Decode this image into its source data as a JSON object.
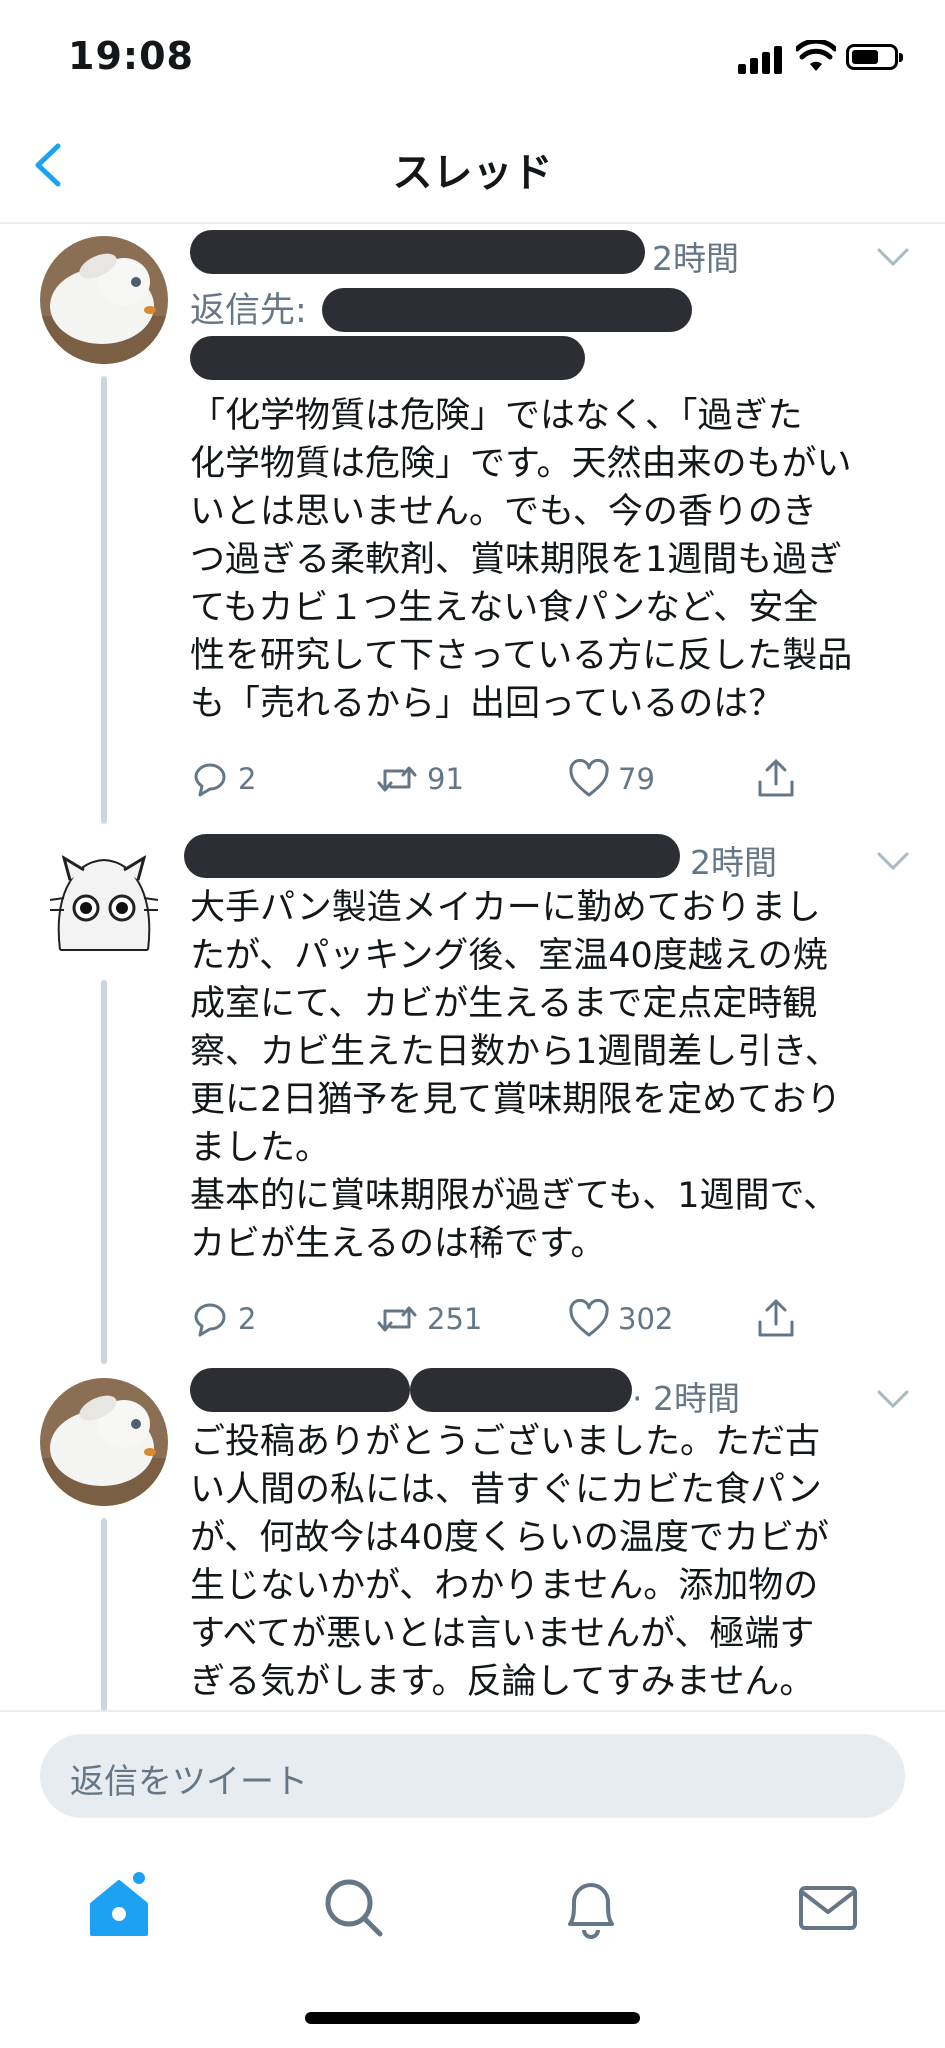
{
  "status_bar": {
    "time": "19:08"
  },
  "nav": {
    "title": "スレッド"
  },
  "tweets": [
    {
      "time": "2時間",
      "reply_to_label": "返信先:",
      "text": "「化学物質は危険」ではなく、「過ぎた\n化学物質は危険」です。天然由来のもがい\nいとは思いません。でも、今の香りのき\nつ過ぎる柔軟剤、賞味期限を1週間も過ぎ\nてもカビ１つ生えない食パンなど、安全\n性を研究して下さっている方に反した製品\nも「売れるから」出回っているのは？",
      "replies": "2",
      "retweets": "91",
      "likes": "79"
    },
    {
      "time": "2時間",
      "text": "大手パン製造メイカーに勤めておりまし\nたが、パッキング後、室温40度越えの焼\n成室にて、カビが生えるまで定点定時観\n察、カビ生えた日数から1週間差し引き、\n更に2日猶予を見て賞味期限を定めており\nました。\n基本的に賞味期限が過ぎても、1週間で、\nカビが生えるのは稀です。",
      "replies": "2",
      "retweets": "251",
      "likes": "302"
    },
    {
      "time": "· 2時間",
      "text": "ご投稿ありがとうございました。ただ古\nい人間の私には、昔すぐにカビた食パン\nが、何故今は40度くらいの温度でカビが\n生じないかが、わかりません。添加物の\nすべてが悪いとは言いませんが、極端す\nぎる気がします。反論してすみません。"
    }
  ],
  "composer": {
    "placeholder": "返信をツイート"
  },
  "colors": {
    "accent": "#1da1f2",
    "muted": "#657786",
    "redaction": "#2d2e33"
  },
  "icons": {
    "tabs": [
      "home-icon",
      "search-icon",
      "notifications-icon",
      "messages-icon"
    ],
    "actions": [
      "reply-icon",
      "retweet-icon",
      "like-icon",
      "share-icon"
    ]
  }
}
